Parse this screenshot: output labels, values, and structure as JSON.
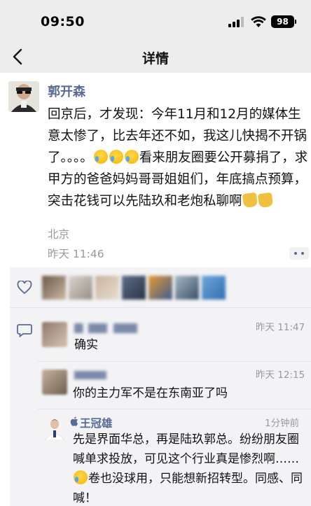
{
  "status_bar": {
    "time": "09:50",
    "battery": "98"
  },
  "nav": {
    "title": "详情"
  },
  "post": {
    "author": "郭开森",
    "text_1": "回京后，才发现：今年11月和12月的媒体生意太惨了，比去年还不如，我这儿快揭不开锅了。。。。",
    "text_2": "看来朋友圈要公开募捐了，求甲方的爸爸妈妈哥哥姐姐们，年底搞点预算，突击花钱可以先陆玖和老炮私聊啊",
    "location": "北京",
    "time": "昨天 11:46"
  },
  "comments": [
    {
      "time": "昨天 11:47",
      "text": "确实"
    },
    {
      "time": "昨天 12:15",
      "text": "你的主力军不是在东南亚了吗"
    },
    {
      "name": "王冠雄",
      "time": "1分钟前",
      "text": "先是界面华总，再是陆玖郭总。纷纷朋友圈喊单求投放，可见这个行业真是惨烈啊……",
      "text_cont": "卷也没球用，只能想新招转型。同感、同喊！"
    }
  ],
  "colors": {
    "link": "#576b95",
    "panel": "#f3f3f5",
    "bar": "#ededed"
  },
  "icons": {
    "back": "chevron-left-icon",
    "like": "heart-icon",
    "comment": "comment-icon",
    "more": "more-icon"
  }
}
